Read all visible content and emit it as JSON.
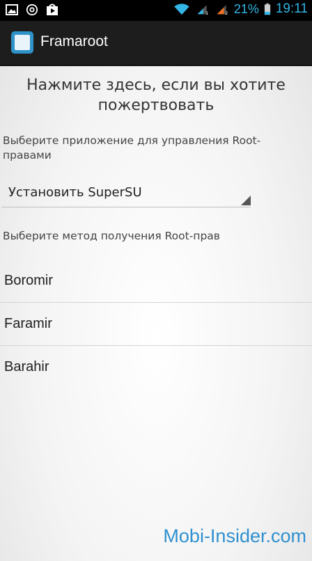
{
  "status_bar": {
    "icons_left": [
      "image-icon",
      "at-icon",
      "play-store-icon"
    ],
    "icons_right": [
      "wifi-icon",
      "signal-1-icon",
      "signal-2-icon",
      "battery-icon"
    ],
    "battery_percent": "21%",
    "time": "19:11"
  },
  "action_bar": {
    "app_title": "Framaroot"
  },
  "main": {
    "donate_text": "Нажмите здесь, если вы хотите пожертвовать",
    "superuser_label": "Выберите приложение для управления Root-правами",
    "superuser_spinner_value": "Установить SuperSU",
    "method_label": "Выберите метод получения Root-прав",
    "methods": [
      {
        "label": "Boromir"
      },
      {
        "label": "Faramir"
      },
      {
        "label": "Barahir"
      }
    ]
  },
  "watermark": "Mobi-Insider.com",
  "colors": {
    "accent": "#33b5e5",
    "action_bar": "#1d1d1d",
    "watermark": "#2f90cf"
  }
}
